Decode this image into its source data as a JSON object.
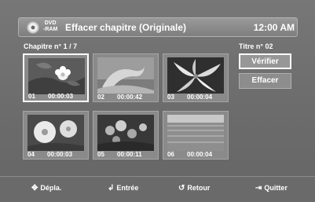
{
  "header": {
    "disc_badge_line1": "DVD",
    "disc_badge_line2": "-RAM",
    "title": "Effacer chapitre (Originale)",
    "time": "12:00 AM"
  },
  "chapter_label": "Chapitre n° 1 / 7",
  "title_label": "Titre n° 02",
  "thumbnails": [
    {
      "number": "01",
      "time": "00:00:03",
      "scene": "flower-on-rock",
      "selected": true
    },
    {
      "number": "02",
      "time": "00:00:42",
      "scene": "dolphin"
    },
    {
      "number": "03",
      "time": "00:00:04",
      "scene": "lily-flower"
    },
    {
      "number": "04",
      "time": "00:00:03",
      "scene": "white-flowers"
    },
    {
      "number": "05",
      "time": "00:00:11",
      "scene": "pink-flowers"
    },
    {
      "number": "06",
      "time": "00:00:04",
      "scene": "field"
    }
  ],
  "buttons": {
    "verify": "Vérifier",
    "delete": "Effacer"
  },
  "footer": {
    "move": "Dépla.",
    "enter": "Entrée",
    "return": "Retour",
    "quit": "Quitter"
  }
}
